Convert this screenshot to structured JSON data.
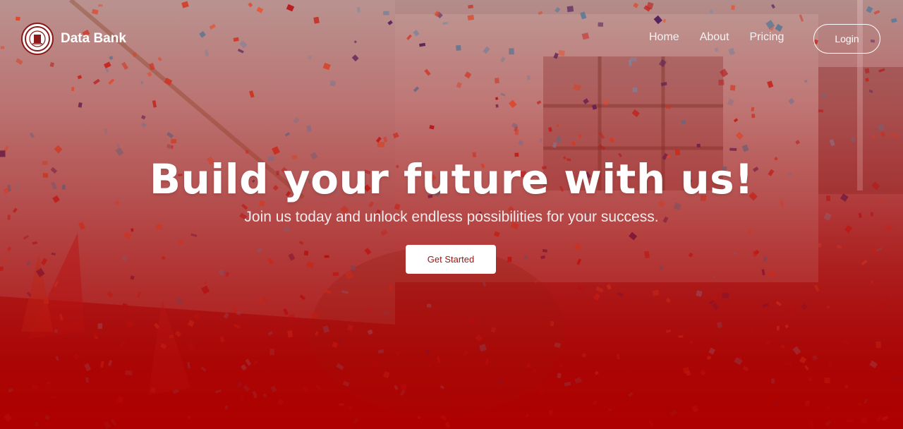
{
  "brand": {
    "name": "Data Bank",
    "logo_icon": "college-seal-icon"
  },
  "nav": {
    "links": [
      "Home",
      "About",
      "Pricing"
    ],
    "login_label": "Login"
  },
  "hero": {
    "title": "Build your future with us!",
    "subtitle": "Join us today and unlock endless possibilities for your success.",
    "cta_label": "Get Started"
  },
  "colors": {
    "accent": "#a80000",
    "text": "#ffffff",
    "cta_text": "#9b1414"
  }
}
